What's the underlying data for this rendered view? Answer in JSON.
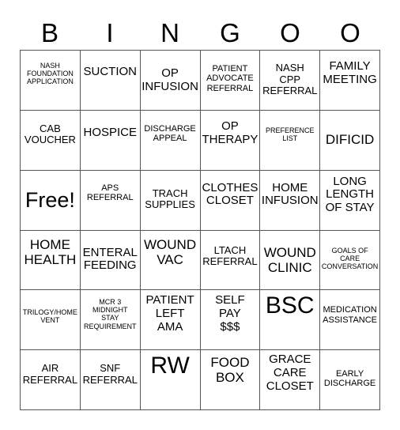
{
  "header": [
    "B",
    "I",
    "N",
    "G",
    "O",
    "O"
  ],
  "rows": [
    [
      {
        "text": "NASH\nFOUNDATION\nAPPLICATION",
        "size": "s1",
        "pad": 14
      },
      {
        "text": "SUCTION",
        "size": "s4",
        "pad": 19
      },
      {
        "text": "OP\nINFUSION",
        "size": "s4",
        "pad": 21
      },
      {
        "text": "PATIENT\nADVOCATE\nREFERRAL",
        "size": "s2",
        "pad": 17
      },
      {
        "text": "NASH\nCPP\nREFERRAL",
        "size": "s3",
        "pad": 15
      },
      {
        "text": "FAMILY\nMEETING",
        "size": "s4",
        "pad": 12
      }
    ],
    [
      {
        "text": "CAB\nVOUCHER",
        "size": "s3",
        "pad": 16
      },
      {
        "text": "HOSPICE",
        "size": "s4",
        "pad": 20
      },
      {
        "text": "DISCHARGE\nAPPEAL",
        "size": "s2",
        "pad": 17
      },
      {
        "text": "OP\nTHERAPY",
        "size": "s4",
        "pad": 12
      },
      {
        "text": "PREFERENCE\nLIST",
        "size": "s1",
        "pad": 20
      },
      {
        "text": "DIFICID",
        "size": "s5",
        "pad": 27
      }
    ],
    [
      {
        "text": "Free!",
        "size": "s6",
        "pad": 22
      },
      {
        "text": "APS\nREFERRAL",
        "size": "s2",
        "pad": 16
      },
      {
        "text": "TRACH\nSUPPLIES",
        "size": "s3",
        "pad": 22
      },
      {
        "text": "CLOTHES\nCLOSET",
        "size": "s4",
        "pad": 14
      },
      {
        "text": "HOME\nINFUSION",
        "size": "s4",
        "pad": 14
      },
      {
        "text": "LONG\nLENGTH\nOF STAY",
        "size": "s4",
        "pad": 6
      }
    ],
    [
      {
        "text": "HOME\nHEALTH",
        "size": "s5",
        "pad": 8
      },
      {
        "text": "ENTERAL\nFEEDING",
        "size": "s4",
        "pad": 20
      },
      {
        "text": "WOUND\nVAC",
        "size": "s5",
        "pad": 8
      },
      {
        "text": "LTACH\nREFERRAL",
        "size": "s3",
        "pad": 18
      },
      {
        "text": "WOUND\nCLINIC",
        "size": "s5",
        "pad": 18
      },
      {
        "text": "GOALS OF\nCARE\nCONVERSATION",
        "size": "s1",
        "pad": 20
      }
    ],
    [
      {
        "text": "TRILOGY/HOME\nVENT",
        "size": "s1",
        "pad": 23
      },
      {
        "text": "MCR 3\nMIDNIGHT\nSTAY\nREQUIREMENT",
        "size": "s1",
        "pad": 10
      },
      {
        "text": "PATIENT\nLEFT\nAMA",
        "size": "s4",
        "pad": 5
      },
      {
        "text": "SELF\nPAY\n$$$",
        "size": "s4",
        "pad": 5
      },
      {
        "text": "BSC",
        "size": "s7",
        "pad": 3
      },
      {
        "text": "MEDICATION\nASSISTANCE",
        "size": "s2",
        "pad": 19
      }
    ],
    [
      {
        "text": "AIR\nREFERRAL",
        "size": "s3",
        "pad": 16
      },
      {
        "text": "SNF\nREFERRAL",
        "size": "s3",
        "pad": 16
      },
      {
        "text": "RW",
        "size": "s7",
        "pad": 3
      },
      {
        "text": "FOOD\nBOX",
        "size": "s5",
        "pad": 6
      },
      {
        "text": "GRACE\nCARE\nCLOSET",
        "size": "s4",
        "pad": 4
      },
      {
        "text": "EARLY\nDISCHARGE",
        "size": "s2",
        "pad": 24
      }
    ]
  ]
}
